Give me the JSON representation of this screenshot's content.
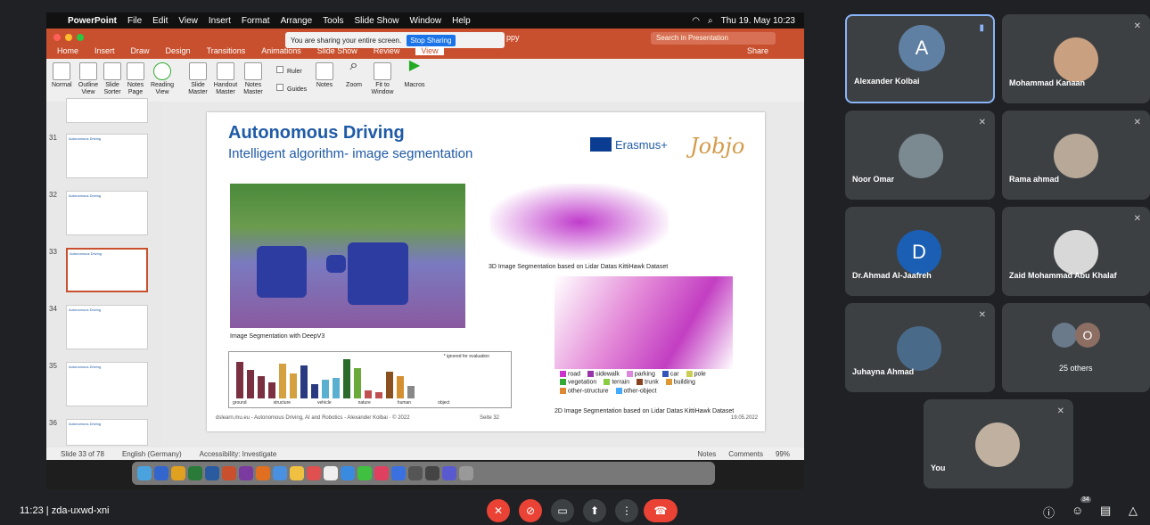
{
  "mac_menu": {
    "apple": "",
    "app": "PowerPoint",
    "items": [
      "File",
      "Edit",
      "View",
      "Insert",
      "Format",
      "Arrange",
      "Tools",
      "Slide Show",
      "Window",
      "Help"
    ],
    "clock": "Thu 19. May 10:23"
  },
  "ppt": {
    "tabs": [
      "Home",
      "Insert",
      "Draw",
      "Design",
      "Transitions",
      "Animations",
      "Slide Show",
      "Review",
      "View"
    ],
    "active_tab": "View",
    "search_placeholder": "Search in Presentation",
    "share_label": "Share",
    "sharing_notice": "You are sharing your entire screen.",
    "stop_sharing": "Stop Sharing",
    "title_fragment": "ppy",
    "ribbon": [
      {
        "label": "Normal"
      },
      {
        "label": "Outline View"
      },
      {
        "label": "Slide Sorter"
      },
      {
        "label": "Notes Page"
      },
      {
        "label": "Reading View"
      },
      {
        "label": "Slide Master"
      },
      {
        "label": "Handout Master"
      },
      {
        "label": "Notes Master"
      },
      {
        "label": "Ruler"
      },
      {
        "label": "Guides"
      },
      {
        "label": "Notes"
      },
      {
        "label": "Zoom"
      },
      {
        "label": "Fit to Window"
      },
      {
        "label": "Macros"
      }
    ],
    "thumbnails": [
      {
        "num": "31",
        "title": "Autonomous Driving"
      },
      {
        "num": "32",
        "title": "Autonomous Driving"
      },
      {
        "num": "33",
        "title": "Autonomous Driving"
      },
      {
        "num": "34",
        "title": "Autonomous Driving"
      },
      {
        "num": "35",
        "title": "Autonomous Driving"
      },
      {
        "num": "36",
        "title": "Autonomous Driving"
      }
    ],
    "slide": {
      "title": "Autonomous Driving",
      "subtitle": "Intelligent algorithm- image segmentation",
      "erasmus": "Erasmus+",
      "jobjo": "Jobjo",
      "caption_main": "Image Segmentation with DeepV3",
      "caption_3d": "3D Image Segmentation based on Lidar Datas KittiHawk Dataset",
      "caption_2d": "2D Image Segmentation based on Lidar Datas KittiHawk Dataset",
      "chart_note": "* ignored for evaluation",
      "chart_groups": [
        "ground",
        "structure",
        "vehicle",
        "nature",
        "human",
        "object"
      ],
      "legend": [
        {
          "label": "road",
          "color": "#cc33cc"
        },
        {
          "label": "sidewalk",
          "color": "#9933aa"
        },
        {
          "label": "parking",
          "color": "#dd88dd"
        },
        {
          "label": "car",
          "color": "#3355bb"
        },
        {
          "label": "pole",
          "color": "#cccc55"
        },
        {
          "label": "vegetation",
          "color": "#33aa33"
        },
        {
          "label": "terrain",
          "color": "#88cc44"
        },
        {
          "label": "trunk",
          "color": "#884422"
        },
        {
          "label": "building",
          "color": "#dd9933"
        },
        {
          "label": "other-structure",
          "color": "#dd8833"
        },
        {
          "label": "other-object",
          "color": "#44aaff"
        }
      ],
      "footer": "dslearn.mu.eu - Autonomous Driving, AI and Robotics - Alexander Kolbai · © 2022",
      "slide_label": "Seite 32",
      "date": "19.05.2022"
    },
    "status": {
      "slide": "Slide 33 of 78",
      "language": "English (Germany)",
      "accessibility": "Accessibility: Investigate",
      "notes": "Notes",
      "comments": "Comments",
      "zoom": "99%"
    }
  },
  "participants": [
    {
      "name": "Alexander Kolbai",
      "initial": "A",
      "color": "#5f7fa3"
    },
    {
      "name": "Mohammad Kanaan"
    },
    {
      "name": "Noor Omar"
    },
    {
      "name": "Rama ahmad"
    },
    {
      "name": "Dr.Ahmad Al-Jaafreh",
      "initial": "D",
      "color": "#1a5fb4"
    },
    {
      "name": "Zaid Mohammad Abu Khalaf"
    },
    {
      "name": "Juhayna Ahmad"
    },
    {
      "name": "25 others",
      "initial": "O",
      "color": "#8d6e63"
    },
    {
      "name": "You"
    }
  ],
  "meet": {
    "time": "11:23",
    "code": "zda-uxwd-xni",
    "people_badge": "34"
  }
}
